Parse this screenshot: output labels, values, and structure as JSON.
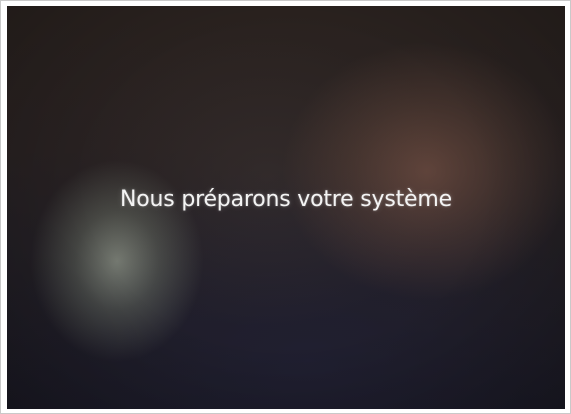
{
  "screen": {
    "message": "Nous préparons votre système"
  }
}
